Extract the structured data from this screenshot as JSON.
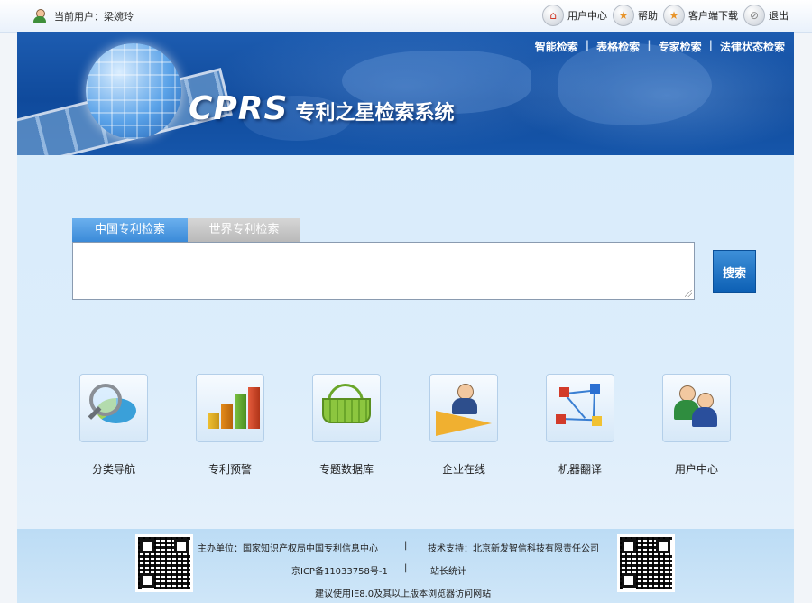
{
  "topbar": {
    "current_user_label": "当前用户：梁婉玲",
    "links": [
      {
        "label": "用户中心",
        "icon": "house-icon"
      },
      {
        "label": "帮助",
        "icon": "star-icon"
      },
      {
        "label": "客户端下载",
        "icon": "star-icon"
      },
      {
        "label": "退出",
        "icon": "exit-icon"
      }
    ]
  },
  "banner": {
    "nav": [
      "智能检索",
      "表格检索",
      "专家检索",
      "法律状态检索"
    ],
    "logo_text": "CPRS",
    "system_title": "专利之星检索系统"
  },
  "search": {
    "tabs": [
      "中国专利检索",
      "世界专利检索"
    ],
    "active_tab": 0,
    "query_value": "",
    "button_label": "搜索"
  },
  "features": [
    {
      "label": "分类导航",
      "icon": "magnifier-pie-icon"
    },
    {
      "label": "专利预警",
      "icon": "bar-chart-icon"
    },
    {
      "label": "专题数据库",
      "icon": "basket-icon"
    },
    {
      "label": "企业在线",
      "icon": "businessman-plane-icon"
    },
    {
      "label": "机器翻译",
      "icon": "network-nodes-icon"
    },
    {
      "label": "用户中心",
      "icon": "users-icon"
    }
  ],
  "footer": {
    "host": "主办单位：国家知识产权局中国专利信息中心",
    "separator": "|",
    "tech": "技术支持：北京新发智信科技有限责任公司",
    "icp": "京ICP备11033758号-1",
    "stats": "站长统计",
    "browser_note": "建议使用IE8.0及其以上版本浏览器访问网站"
  },
  "colors": {
    "banner_blue": "#0f4a9c",
    "active_tab": "#3a8ad8",
    "search_button": "#0c5fb4"
  }
}
